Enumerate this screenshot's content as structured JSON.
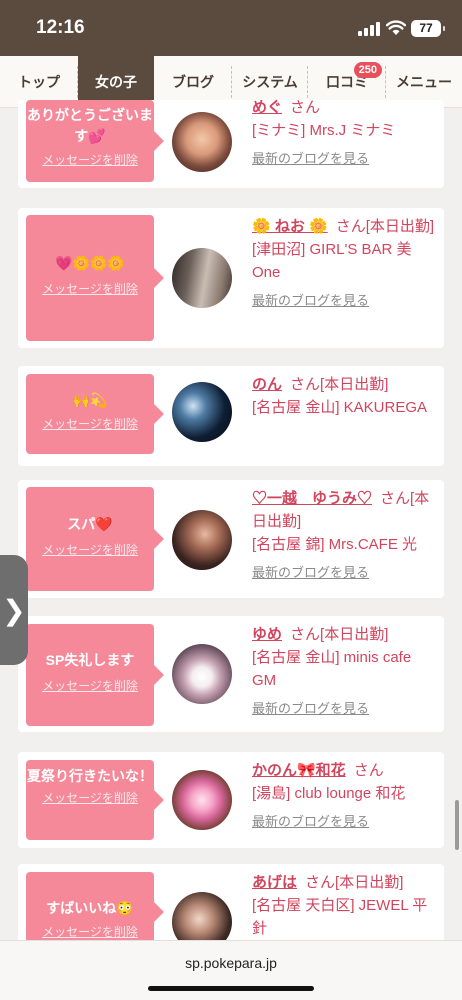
{
  "status": {
    "time": "12:16",
    "battery": "77"
  },
  "nav": {
    "tabs": [
      {
        "label": "トップ"
      },
      {
        "label": "女の子"
      },
      {
        "label": "ブログ"
      },
      {
        "label": "システム"
      },
      {
        "label": "口コミ",
        "badge": "250"
      },
      {
        "label": "メニュー"
      }
    ]
  },
  "cards": [
    {
      "message": "ありがとうございます💕",
      "delete_label": "メッセージを削除",
      "name": "めぐ",
      "san": "さん",
      "status": "",
      "shop": "[ミナミ] Mrs.J ミナミ",
      "blog_link": "最新のブログを見る"
    },
    {
      "message": "💗🌼🌼🌼",
      "delete_label": "メッセージを削除",
      "name": "🌼 ねお 🌼",
      "san": "さん",
      "status": "[本日出勤]",
      "shop": "[津田沼] GIRL'S BAR 美One",
      "blog_link": "最新のブログを見る"
    },
    {
      "message": "🙌💫",
      "delete_label": "メッセージを削除",
      "name": "のん",
      "san": "さん",
      "status": "[本日出勤]",
      "shop": "[名古屋 金山] KAKUREGA",
      "blog_link": ""
    },
    {
      "message": "スパ❤️",
      "delete_label": "メッセージを削除",
      "name": "♡一越　ゆうみ♡",
      "san": "さん",
      "status": "[本日出勤]",
      "shop": "[名古屋 錦] Mrs.CAFE 光",
      "blog_link": "最新のブログを見る"
    },
    {
      "message": "SP失礼します",
      "delete_label": "メッセージを削除",
      "name": "ゆめ",
      "san": "さん",
      "status": "[本日出勤]",
      "shop": "[名古屋 金山] minis cafe GM",
      "blog_link": "最新のブログを見る"
    },
    {
      "message": "夏祭り行きたいな！",
      "delete_label": "メッセージを削除",
      "name": "かのん🎀和花",
      "san": "さん",
      "status": "",
      "shop": "[湯島] club lounge 和花",
      "blog_link": "最新のブログを見る"
    },
    {
      "message": "すばいいね😳",
      "delete_label": "メッセージを削除",
      "name": "あげは",
      "san": "さん",
      "status": "[本日出勤]",
      "shop": "[名古屋 天白区] JEWEL 平針",
      "blog_link": ""
    }
  ],
  "side_handle": {
    "icon": "chevron-right-icon",
    "glyph": "❯"
  },
  "url_bar": {
    "url": "sp.pokepara.jp"
  },
  "colors": {
    "header": "#5b4a3e",
    "accent": "#d2455e",
    "message_bg": "#f5899a",
    "badge": "#e8505b"
  }
}
